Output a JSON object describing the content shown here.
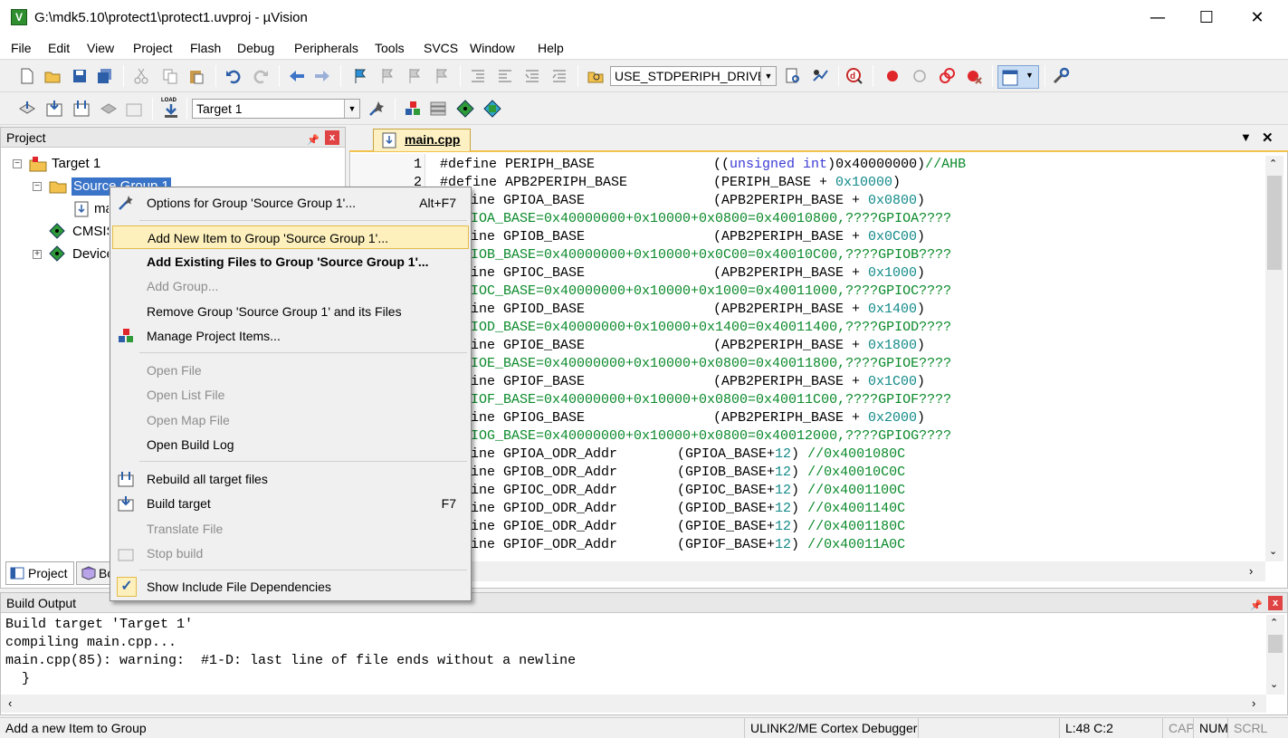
{
  "window": {
    "title": "G:\\mdk5.10\\protect1\\protect1.uvproj - µVision",
    "minimize": "—",
    "maximize": "☐",
    "close": "✕"
  },
  "menubar": [
    "File",
    "Edit",
    "View",
    "Project",
    "Flash",
    "Debug",
    "Peripherals",
    "Tools",
    "SVCS",
    "Window",
    "Help"
  ],
  "toolbar1": {
    "define_combo": "USE_STDPERIPH_DRIVER"
  },
  "toolbar2": {
    "target_combo": "Target 1",
    "load_label": "LOAD"
  },
  "project_panel": {
    "title": "Project",
    "pin": "ᵖ",
    "close": "x",
    "tree": {
      "root": "Target 1",
      "group": "Source Group 1",
      "file": "main.cpp",
      "cmsis": "CMSIS",
      "device": "Device"
    },
    "tabs": [
      "Project",
      "Books"
    ]
  },
  "editor": {
    "tab": "main.cpp",
    "line_numbers": [
      "1",
      "2"
    ],
    "lines": [
      {
        "a": "#define PERIPH_BASE",
        "b": "((unsigned int)0x40000000)//AHB"
      },
      {
        "a": "#define APB2PERIPH_BASE",
        "b": "(PERIPH_BASE + 0x10000)"
      },
      {
        "a": "ine GPIOA_BASE",
        "b": "(APB2PERIPH_BASE + 0x0800)"
      },
      {
        "c": "IOA_BASE=0x40000000+0x10000+0x0800=0x40010800,????GPIOA????"
      },
      {
        "a": "ine GPIOB_BASE",
        "b": "(APB2PERIPH_BASE + 0x0C00)"
      },
      {
        "c": "IOB_BASE=0x40000000+0x10000+0x0C00=0x40010C00,????GPIOB????"
      },
      {
        "a": "ine GPIOC_BASE",
        "b": "(APB2PERIPH_BASE + 0x1000)"
      },
      {
        "c": "IOC_BASE=0x40000000+0x10000+0x1000=0x40011000,????GPIOC????"
      },
      {
        "a": "ine GPIOD_BASE",
        "b": "(APB2PERIPH_BASE + 0x1400)"
      },
      {
        "c": "IOD_BASE=0x40000000+0x10000+0x1400=0x40011400,????GPIOD????"
      },
      {
        "a": "ine GPIOE_BASE",
        "b": "(APB2PERIPH_BASE + 0x1800)"
      },
      {
        "c": "IOE_BASE=0x40000000+0x10000+0x0800=0x40011800,????GPIOE????"
      },
      {
        "a": "ine GPIOF_BASE",
        "b": "(APB2PERIPH_BASE + 0x1C00)"
      },
      {
        "c": "IOF_BASE=0x40000000+0x10000+0x0800=0x40011C00,????GPIOF????"
      },
      {
        "a": "ine GPIOG_BASE",
        "b": "(APB2PERIPH_BASE + 0x2000)"
      },
      {
        "c": "IOG_BASE=0x40000000+0x10000+0x0800=0x40012000,????GPIOG????"
      },
      {
        "a": "ine GPIOA_ODR_Addr",
        "b": "(GPIOA_BASE+12) //0x4001080C"
      },
      {
        "a": "ine GPIOB_ODR_Addr",
        "b": "(GPIOB_BASE+12) //0x40010C0C"
      },
      {
        "a": "ine GPIOC_ODR_Addr",
        "b": "(GPIOC_BASE+12) //0x4001100C"
      },
      {
        "a": "ine GPIOD_ODR_Addr",
        "b": "(GPIOD_BASE+12) //0x4001140C"
      },
      {
        "a": "ine GPIOE_ODR_Addr",
        "b": "(GPIOE_BASE+12) //0x4001180C"
      },
      {
        "a": "ine GPIOF_ODR_Addr",
        "b": "(GPIOF_BASE+12) //0x40011A0C"
      }
    ]
  },
  "context_menu": {
    "options": {
      "label": "Options for Group 'Source Group 1'...",
      "shortcut": "Alt+F7"
    },
    "add_new": "Add New  Item to Group 'Source Group 1'...",
    "add_existing": "Add Existing Files to Group 'Source Group 1'...",
    "add_group": "Add Group...",
    "remove_group": "Remove Group 'Source Group 1' and its Files",
    "manage": "Manage Project Items...",
    "open_file": "Open File",
    "open_list": "Open List File",
    "open_map": "Open Map File",
    "open_build_log": "Open Build Log",
    "rebuild": "Rebuild all target files",
    "build": {
      "label": "Build target",
      "shortcut": "F7"
    },
    "translate": "Translate File",
    "stop": "Stop build",
    "show_include": "Show Include File Dependencies"
  },
  "build_output": {
    "title": "Build Output",
    "lines": [
      "Build target 'Target 1'",
      "compiling main.cpp...",
      "main.cpp(85): warning:  #1-D: last line of file ends without a newline",
      "  }"
    ]
  },
  "statusbar": {
    "message": "Add a new Item to Group",
    "debugger": "ULINK2/ME Cortex Debugger",
    "position": "L:48 C:2",
    "cap": "CAP",
    "num": "NUM",
    "scrl": "SCRL"
  }
}
